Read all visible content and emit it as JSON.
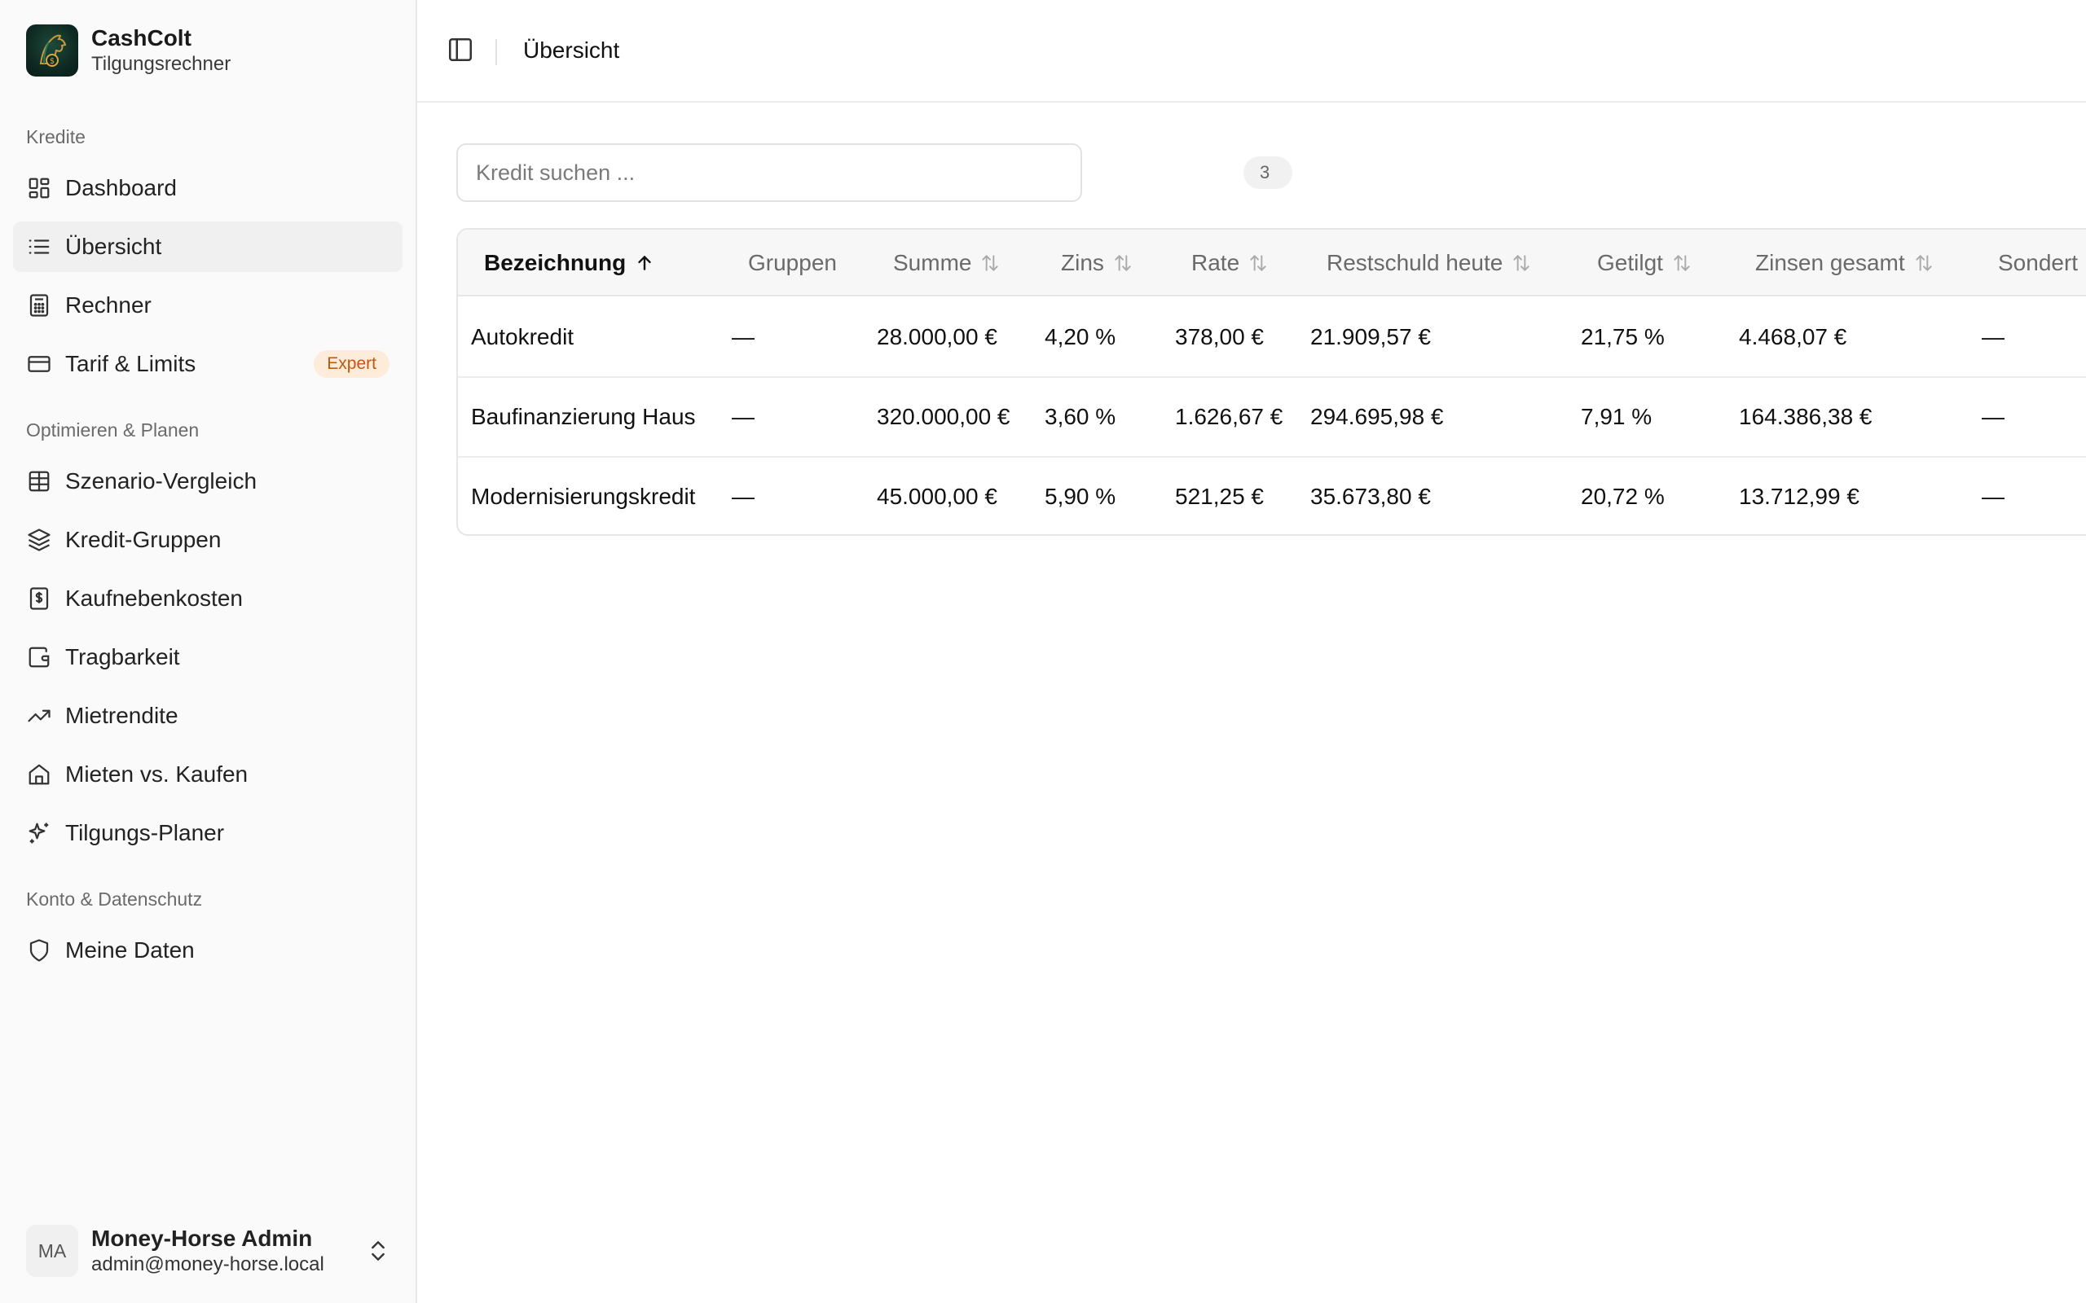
{
  "brand": {
    "name": "CashColt",
    "subtitle": "Tilgungsrechner"
  },
  "sidebar": {
    "sections": [
      {
        "label": "Kredite"
      },
      {
        "label": "Optimieren & Planen"
      },
      {
        "label": "Konto & Datenschutz"
      }
    ],
    "items": [
      {
        "label": "Dashboard",
        "icon": "layout-dashboard-icon",
        "active": false
      },
      {
        "label": "Übersicht",
        "icon": "list-icon",
        "active": true
      },
      {
        "label": "Rechner",
        "icon": "calculator-icon",
        "active": false
      },
      {
        "label": "Tarif & Limits",
        "icon": "credit-card-icon",
        "active": false,
        "badge": "Expert"
      },
      {
        "label": "Szenario-Vergleich",
        "icon": "table-icon",
        "active": false
      },
      {
        "label": "Kredit-Gruppen",
        "icon": "layers-icon",
        "active": false
      },
      {
        "label": "Kaufnebenkosten",
        "icon": "receipt-dollar-icon",
        "active": false
      },
      {
        "label": "Tragbarkeit",
        "icon": "wallet-icon",
        "active": false
      },
      {
        "label": "Mietrendite",
        "icon": "trending-up-icon",
        "active": false
      },
      {
        "label": "Mieten vs. Kaufen",
        "icon": "home-icon",
        "active": false
      },
      {
        "label": "Tilgungs-Planer",
        "icon": "sparkles-icon",
        "active": false
      },
      {
        "label": "Meine Daten",
        "icon": "shield-icon",
        "active": false
      }
    ]
  },
  "user": {
    "initials": "MA",
    "name": "Money-Horse Admin",
    "email": "admin@money-horse.local"
  },
  "header": {
    "title": "Übersicht"
  },
  "search": {
    "placeholder": "Kredit suchen ...",
    "value": ""
  },
  "count": {
    "label": "3"
  },
  "table": {
    "columns": [
      {
        "label": "Bezeichnung",
        "sort": "asc"
      },
      {
        "label": "Gruppen",
        "sort": "none"
      },
      {
        "label": "Summe",
        "sort": "both"
      },
      {
        "label": "Zins",
        "sort": "both"
      },
      {
        "label": "Rate",
        "sort": "both"
      },
      {
        "label": "Restschuld heute",
        "sort": "both"
      },
      {
        "label": "Getilgt",
        "sort": "both"
      },
      {
        "label": "Zinsen gesamt",
        "sort": "both"
      },
      {
        "label": "Sondert",
        "sort": "none"
      }
    ],
    "rows": [
      [
        "Autokredit",
        "—",
        "28.000,00 €",
        "4,20 %",
        "378,00 €",
        "21.909,57 €",
        "21,75 %",
        "4.468,07 €",
        "—"
      ],
      [
        "Baufinanzierung Haus",
        "—",
        "320.000,00 €",
        "3,60 %",
        "1.626,67 €",
        "294.695,98 €",
        "7,91 %",
        "164.386,38 €",
        "—"
      ],
      [
        "Modernisierungskredit",
        "—",
        "45.000,00 €",
        "5,90 %",
        "521,25 €",
        "35.673,80 €",
        "20,72 %",
        "13.712,99 €",
        "—"
      ]
    ]
  },
  "colors": {
    "accent_badge_bg": "#fdecd9",
    "accent_badge_text": "#c2570c",
    "active_item_bg": "#f0f0f0"
  }
}
